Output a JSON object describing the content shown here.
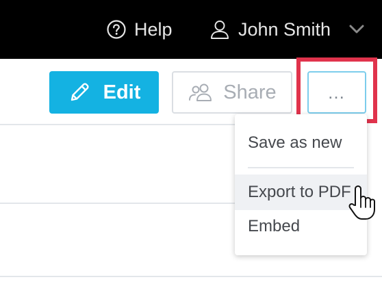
{
  "header": {
    "help_label": "Help",
    "help_icon": "question-circle-icon",
    "user_name": "John Smith",
    "user_icon": "user-icon",
    "user_menu_icon": "chevron-down-icon"
  },
  "toolbar": {
    "edit_label": "Edit",
    "edit_icon": "pencil-icon",
    "share_label": "Share",
    "share_icon": "users-icon",
    "more_label": "…",
    "accent_color": "#14b2e2",
    "highlight_color": "#e0334c"
  },
  "menu": {
    "items": [
      {
        "label": "Save as new"
      },
      {
        "label": "Export to PDF",
        "hovered": true
      },
      {
        "label": "Embed"
      }
    ]
  },
  "cursor": "hand-pointer-icon"
}
